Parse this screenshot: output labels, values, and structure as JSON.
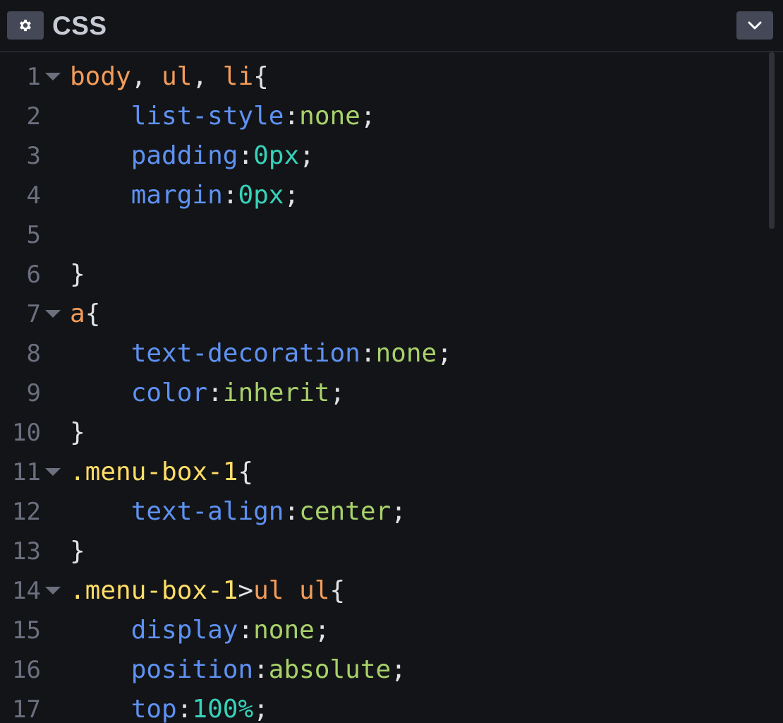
{
  "header": {
    "title": "CSS",
    "settings_icon": "gear-icon",
    "collapse_icon": "chevron-down-icon"
  },
  "colors": {
    "selector": "#f39c5a",
    "class_selector": "#ffdd66",
    "property": "#5e91f2",
    "value": "#a8d16a",
    "number": "#37d2b9",
    "punctuation": "#e1e2e6",
    "line_number": "#6b6f7e"
  },
  "lines": [
    {
      "n": "1",
      "fold": true,
      "tokens": [
        [
          "sel",
          "body"
        ],
        [
          "punc",
          ", "
        ],
        [
          "sel",
          "ul"
        ],
        [
          "punc",
          ", "
        ],
        [
          "sel",
          "li"
        ],
        [
          "punc",
          "{"
        ]
      ]
    },
    {
      "n": "2",
      "fold": false,
      "tokens": [
        [
          "punc",
          "    "
        ],
        [
          "prop",
          "list-style"
        ],
        [
          "punc",
          ":"
        ],
        [
          "val",
          "none"
        ],
        [
          "punc",
          ";"
        ]
      ]
    },
    {
      "n": "3",
      "fold": false,
      "tokens": [
        [
          "punc",
          "    "
        ],
        [
          "prop",
          "padding"
        ],
        [
          "punc",
          ":"
        ],
        [
          "num",
          "0px"
        ],
        [
          "punc",
          ";"
        ]
      ]
    },
    {
      "n": "4",
      "fold": false,
      "tokens": [
        [
          "punc",
          "    "
        ],
        [
          "prop",
          "margin"
        ],
        [
          "punc",
          ":"
        ],
        [
          "num",
          "0px"
        ],
        [
          "punc",
          ";"
        ]
      ]
    },
    {
      "n": "5",
      "fold": false,
      "tokens": []
    },
    {
      "n": "6",
      "fold": false,
      "tokens": [
        [
          "punc",
          "}"
        ]
      ]
    },
    {
      "n": "7",
      "fold": true,
      "tokens": [
        [
          "sel",
          "a"
        ],
        [
          "punc",
          "{"
        ]
      ]
    },
    {
      "n": "8",
      "fold": false,
      "tokens": [
        [
          "punc",
          "    "
        ],
        [
          "prop",
          "text-decoration"
        ],
        [
          "punc",
          ":"
        ],
        [
          "val",
          "none"
        ],
        [
          "punc",
          ";"
        ]
      ]
    },
    {
      "n": "9",
      "fold": false,
      "tokens": [
        [
          "punc",
          "    "
        ],
        [
          "prop",
          "color"
        ],
        [
          "punc",
          ":"
        ],
        [
          "val",
          "inherit"
        ],
        [
          "punc",
          ";"
        ]
      ]
    },
    {
      "n": "10",
      "fold": false,
      "tokens": [
        [
          "punc",
          "}"
        ]
      ]
    },
    {
      "n": "11",
      "fold": true,
      "tokens": [
        [
          "cls",
          ".menu-box-1"
        ],
        [
          "punc",
          "{"
        ]
      ]
    },
    {
      "n": "12",
      "fold": false,
      "tokens": [
        [
          "punc",
          "    "
        ],
        [
          "prop",
          "text-align"
        ],
        [
          "punc",
          ":"
        ],
        [
          "val",
          "center"
        ],
        [
          "punc",
          ";"
        ]
      ]
    },
    {
      "n": "13",
      "fold": false,
      "tokens": [
        [
          "punc",
          "}"
        ]
      ]
    },
    {
      "n": "14",
      "fold": true,
      "tokens": [
        [
          "cls",
          ".menu-box-1"
        ],
        [
          "punc",
          ">"
        ],
        [
          "sel",
          "ul"
        ],
        [
          "punc",
          " "
        ],
        [
          "sel",
          "ul"
        ],
        [
          "punc",
          "{"
        ]
      ]
    },
    {
      "n": "15",
      "fold": false,
      "tokens": [
        [
          "punc",
          "    "
        ],
        [
          "prop",
          "display"
        ],
        [
          "punc",
          ":"
        ],
        [
          "val",
          "none"
        ],
        [
          "punc",
          ";"
        ]
      ]
    },
    {
      "n": "16",
      "fold": false,
      "tokens": [
        [
          "punc",
          "    "
        ],
        [
          "prop",
          "position"
        ],
        [
          "punc",
          ":"
        ],
        [
          "val",
          "absolute"
        ],
        [
          "punc",
          ";"
        ]
      ]
    },
    {
      "n": "17",
      "fold": false,
      "tokens": [
        [
          "punc",
          "    "
        ],
        [
          "prop",
          "top"
        ],
        [
          "punc",
          ":"
        ],
        [
          "num",
          "100%"
        ],
        [
          "punc",
          ";"
        ]
      ]
    }
  ]
}
